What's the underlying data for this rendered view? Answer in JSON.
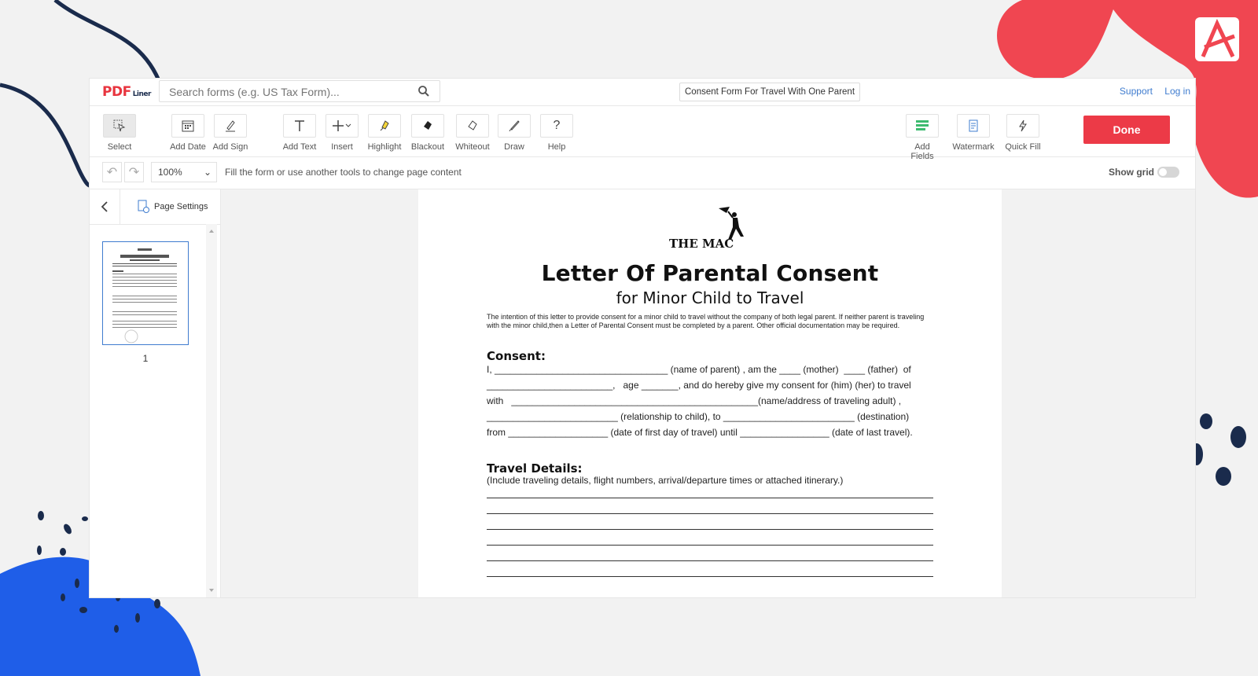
{
  "colors": {
    "accent_red": "#ec3a47",
    "link_blue": "#3f7ccf",
    "deco_navy": "#1a2b4c",
    "deco_blue": "#1f5ee8",
    "deco_red": "#f04651"
  },
  "header": {
    "logo_main": "PDF",
    "logo_sub": "Liner",
    "search_placeholder": "Search forms (e.g. US Tax Form)...",
    "document_title": "Consent Form For Travel With One Parent",
    "support_link": "Support",
    "login_link": "Log in"
  },
  "toolbar": {
    "select": "Select",
    "add_date": "Add Date",
    "add_sign": "Add Sign",
    "add_text": "Add Text",
    "insert": "Insert",
    "highlight": "Highlight",
    "blackout": "Blackout",
    "whiteout": "Whiteout",
    "draw": "Draw",
    "help": "Help",
    "add_fields": "Add Fields",
    "watermark": "Watermark",
    "quick_fill": "Quick Fill",
    "done": "Done"
  },
  "subbar": {
    "zoom": "100%",
    "hint": "Fill the form or use another tools to change page content",
    "show_grid": "Show grid"
  },
  "sidebar": {
    "page_settings": "Page Settings",
    "page_number": "1"
  },
  "document": {
    "logo_text": "THE MAC",
    "title": "Letter Of Parental Consent",
    "subtitle": "for Minor Child to Travel",
    "intro": "The intention of this letter to provide consent for a minor child to travel without the company of both legal parent. If neither parent is traveling with the minor child,then a Letter of Parental Consent must be completed by a parent. Other official documentation may be required.",
    "consent_heading": "Consent:",
    "consent_lines": [
      "I, _________________________________ (name of parent) , am the ____ (mother)  ____ (father)  of",
      "________________________,   age _______, and do hereby give my consent for (him) (her) to travel",
      "with   _______________________________________________(name/address of traveling adult) ,",
      "_________________________ (relationship to child), to _________________________ (destination)",
      "from ___________________ (date of first day of travel) until _________________ (date of last travel)."
    ],
    "travel_heading": "Travel Details:",
    "travel_note": "(Include traveling details, flight numbers, arrival/departure times or attached itinerary.)"
  }
}
